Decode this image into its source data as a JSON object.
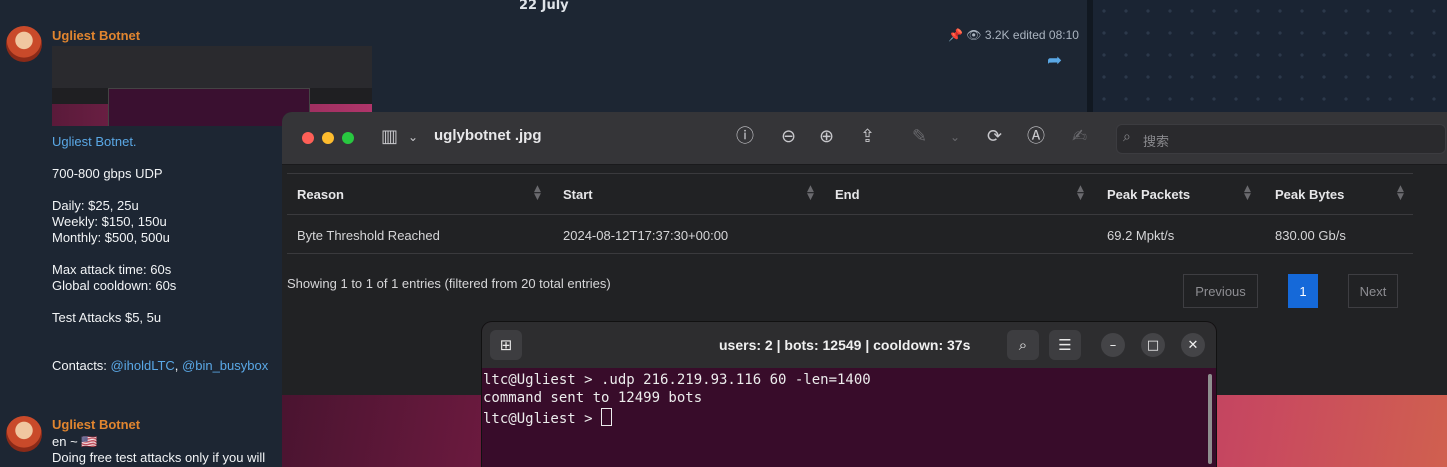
{
  "chat": {
    "date": "22 July",
    "post1": {
      "sender": "Ugliest Botnet",
      "views": "3.2K",
      "edited": "edited 08:10",
      "title_link": "Ugliest Botnet.",
      "line_speed": "700-800 gbps UDP",
      "daily": "Daily: $25, 25u",
      "weekly": "Weekly: $150, 150u",
      "monthly": "Monthly: $500, 500u",
      "max_attack": "Max attack time: 60s",
      "cooldown": "Global cooldown: 60s",
      "test": "Test Attacks $5, 5u",
      "contacts_label": "Contacts: ",
      "contact1": "@iholdLTC",
      "contact_sep": ", ",
      "contact2": "@bin_busybox"
    },
    "post2": {
      "sender": "Ugliest Botnet",
      "line1": "en ~ 🇺🇸",
      "line2": "Doing free test attacks only if you will"
    }
  },
  "viewer": {
    "title": "uglybotnet .jpg",
    "search_placeholder": "搜索",
    "table": {
      "headers": [
        "Reason",
        "Start",
        "End",
        "Peak Packets",
        "Peak Bytes"
      ],
      "row": [
        "Byte Threshold Reached",
        "2024-08-12T17:37:30+00:00",
        "",
        "69.2 Mpkt/s",
        "830.00 Gb/s"
      ],
      "info": "Showing 1 to 1 of 1 entries (filtered from 20 total entries)",
      "prev": "Previous",
      "page": "1",
      "next": "Next"
    }
  },
  "terminal": {
    "title": "users: 2 | bots: 12549 | cooldown: 37s",
    "line1": "ltc@Ugliest > .udp 216.219.93.116 60 -len=1400",
    "line2": "command sent to 12499 bots",
    "prompt": "ltc@Ugliest > "
  },
  "colors": {
    "sender": "#e1852f",
    "link": "#5aa8e6",
    "terminal_bg": "#380c2a",
    "page_active": "#1569d9"
  }
}
